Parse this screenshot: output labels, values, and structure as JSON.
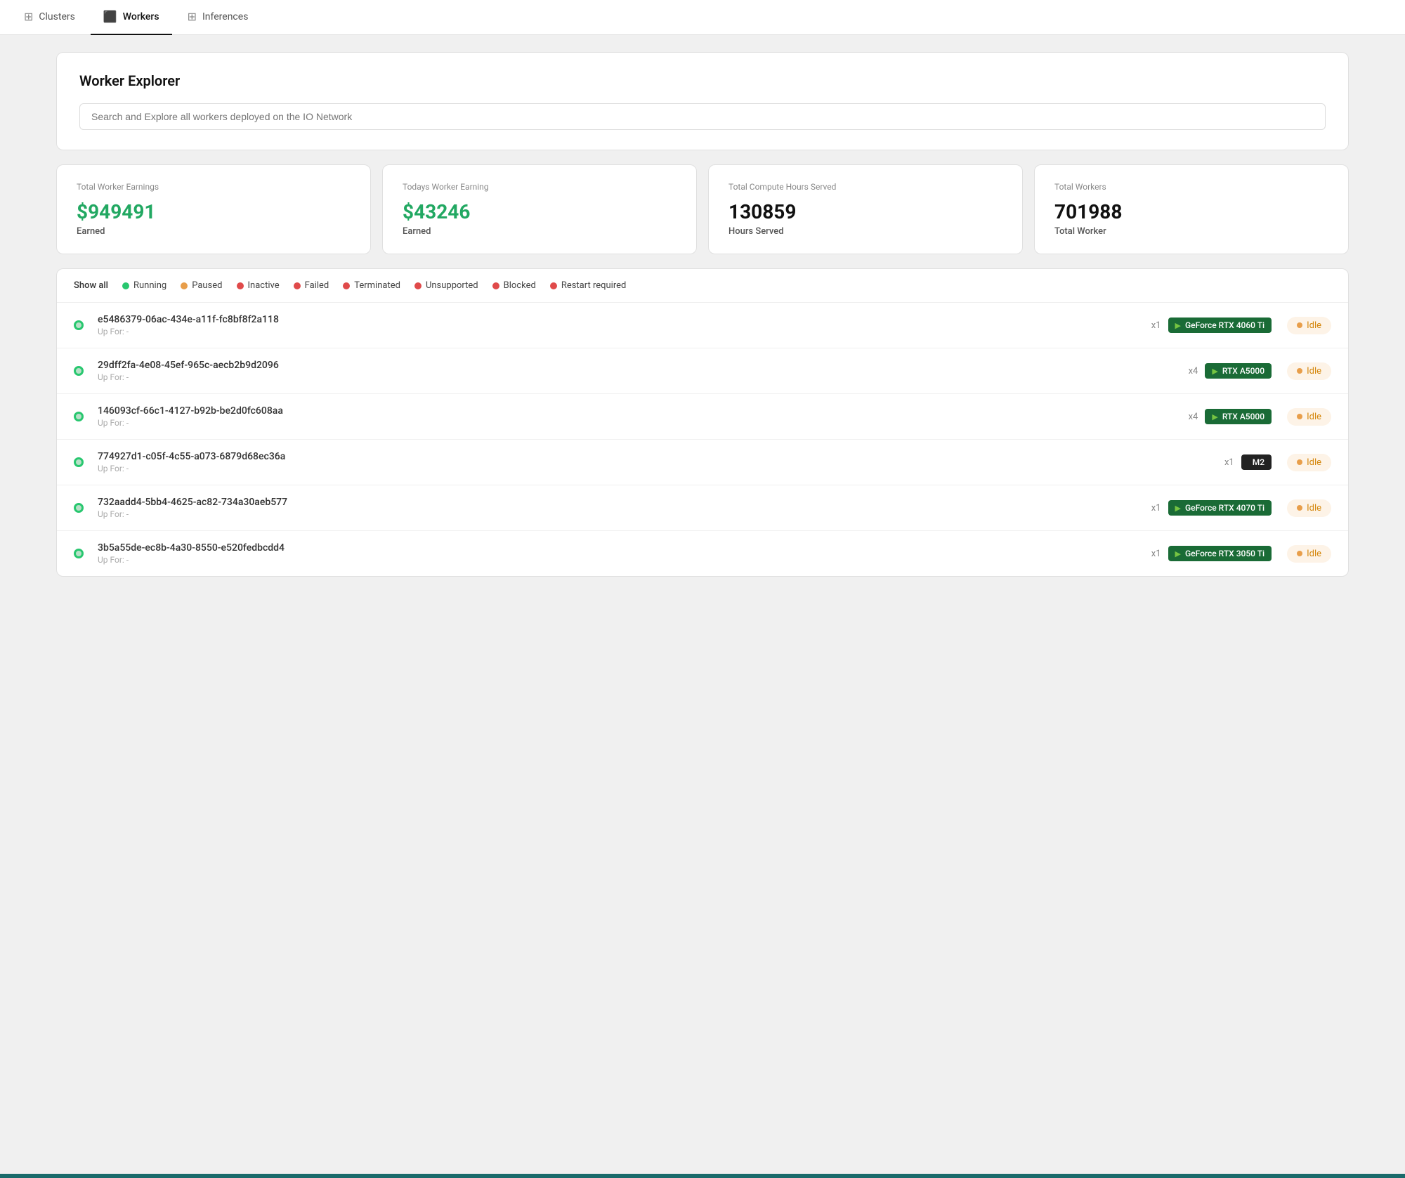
{
  "nav": {
    "tabs": [
      {
        "id": "clusters",
        "label": "Clusters",
        "icon": "⊞",
        "active": false
      },
      {
        "id": "workers",
        "label": "Workers",
        "icon": "⬛",
        "active": true
      },
      {
        "id": "inferences",
        "label": "Inferences",
        "icon": "⊞",
        "active": false
      }
    ]
  },
  "workerExplorer": {
    "title": "Worker Explorer",
    "searchPlaceholder": "Search and Explore all workers deployed on the IO Network"
  },
  "stats": [
    {
      "id": "total-earnings",
      "label": "Total Worker Earnings",
      "value": "$949491",
      "valueClass": "green",
      "sublabel": "Earned"
    },
    {
      "id": "todays-earnings",
      "label": "Todays Worker Earning",
      "value": "$43246",
      "valueClass": "green",
      "sublabel": "Earned"
    },
    {
      "id": "compute-hours",
      "label": "Total Compute Hours Served",
      "value": "130859",
      "valueClass": "",
      "sublabel": "Hours Served"
    },
    {
      "id": "total-workers",
      "label": "Total Workers",
      "value": "701988",
      "valueClass": "",
      "sublabel": "Total Worker"
    }
  ],
  "filters": {
    "showAll": "Show all",
    "items": [
      {
        "id": "running",
        "label": "Running",
        "dotClass": "dot-green"
      },
      {
        "id": "paused",
        "label": "Paused",
        "dotClass": "dot-orange"
      },
      {
        "id": "inactive",
        "label": "Inactive",
        "dotClass": "dot-red"
      },
      {
        "id": "failed",
        "label": "Failed",
        "dotClass": "dot-red"
      },
      {
        "id": "terminated",
        "label": "Terminated",
        "dotClass": "dot-red"
      },
      {
        "id": "unsupported",
        "label": "Unsupported",
        "dotClass": "dot-red"
      },
      {
        "id": "blocked",
        "label": "Blocked",
        "dotClass": "dot-red"
      },
      {
        "id": "restart-required",
        "label": "Restart required",
        "dotClass": "dot-red"
      }
    ]
  },
  "workers": [
    {
      "id": "e5486379-06ac-434e-a11f-fc8bf8f2a118",
      "uptime": "Up For: -",
      "gpuCount": "x1",
      "gpuType": "nvidia",
      "gpuName": "GeForce RTX 4060 Ti",
      "status": "Idle"
    },
    {
      "id": "29dff2fa-4e08-45ef-965c-aecb2b9d2096",
      "uptime": "Up For: -",
      "gpuCount": "x4",
      "gpuType": "nvidia",
      "gpuName": "RTX A5000",
      "status": "Idle"
    },
    {
      "id": "146093cf-66c1-4127-b92b-be2d0fc608aa",
      "uptime": "Up For: -",
      "gpuCount": "x4",
      "gpuType": "nvidia",
      "gpuName": "RTX A5000",
      "status": "Idle"
    },
    {
      "id": "774927d1-c05f-4c55-a073-6879d68ec36a",
      "uptime": "Up For: -",
      "gpuCount": "x1",
      "gpuType": "apple",
      "gpuName": "M2",
      "status": "Idle"
    },
    {
      "id": "732aadd4-5bb4-4625-ac82-734a30aeb577",
      "uptime": "Up For: -",
      "gpuCount": "x1",
      "gpuType": "nvidia",
      "gpuName": "GeForce RTX 4070 Ti",
      "status": "Idle"
    },
    {
      "id": "3b5a55de-ec8b-4a30-8550-e520fedbcdd4",
      "uptime": "Up For: -",
      "gpuCount": "x1",
      "gpuType": "nvidia",
      "gpuName": "GeForce RTX 3050 Ti",
      "status": "Idle"
    }
  ],
  "idleLabel": "Idle",
  "uptimePrefix": "Up For: -"
}
